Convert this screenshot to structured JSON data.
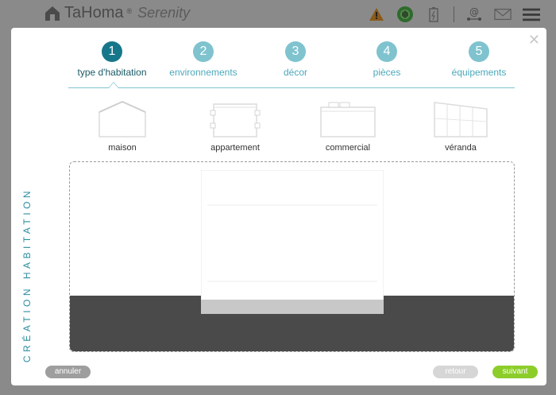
{
  "app": {
    "brand": "TaHoma",
    "brand_mark": "®",
    "product": "Serenity"
  },
  "header_icons": [
    "warning-icon",
    "shield-icon",
    "battery-icon",
    "network-icon",
    "mail-icon",
    "menu-icon"
  ],
  "modal": {
    "side_title": "CRÉATION HABITATION",
    "close_glyph": "✕"
  },
  "steps": [
    {
      "number": "1",
      "label": "type d'habitation",
      "active": true
    },
    {
      "number": "2",
      "label": "environnements",
      "active": false
    },
    {
      "number": "3",
      "label": "décor",
      "active": false
    },
    {
      "number": "4",
      "label": "pièces",
      "active": false
    },
    {
      "number": "5",
      "label": "équipements",
      "active": false
    }
  ],
  "home_types": [
    {
      "label": "maison"
    },
    {
      "label": "appartement"
    },
    {
      "label": "commercial"
    },
    {
      "label": "véranda"
    }
  ],
  "buttons": {
    "cancel": "annuler",
    "back": "retour",
    "next": "suivant"
  },
  "colors": {
    "accent": "#17778a",
    "accent_light": "#7fc3cf",
    "next": "#8ccd2a",
    "ground": "#4a4a4a"
  }
}
